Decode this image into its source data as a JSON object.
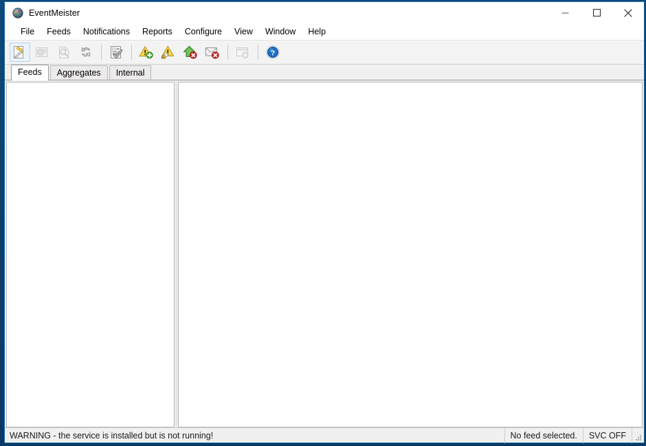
{
  "window": {
    "title": "EventMeister",
    "app_icon": "app-globe-icon",
    "controls": {
      "minimize": "Minimize",
      "maximize": "Maximize",
      "close": "Close"
    }
  },
  "menubar": {
    "items": [
      {
        "label": "File"
      },
      {
        "label": "Feeds"
      },
      {
        "label": "Notifications"
      },
      {
        "label": "Reports"
      },
      {
        "label": "Configure"
      },
      {
        "label": "View"
      },
      {
        "label": "Window"
      },
      {
        "label": "Help"
      }
    ]
  },
  "toolbar": {
    "buttons": [
      {
        "icon": "new-feed-wand-icon",
        "title": "New feed",
        "enabled": true,
        "selected": true
      },
      {
        "icon": "edit-feed-icon",
        "title": "Edit feed",
        "enabled": false,
        "selected": false
      },
      {
        "icon": "view-feed-icon",
        "title": "View feed",
        "enabled": false,
        "selected": false
      },
      {
        "icon": "refresh-icon",
        "title": "Refresh",
        "enabled": true,
        "selected": false
      },
      {
        "separator": true
      },
      {
        "icon": "document-check-icon",
        "title": "Acknowledge",
        "enabled": true,
        "selected": false
      },
      {
        "separator": true
      },
      {
        "icon": "warning-add-icon",
        "title": "Add notification",
        "enabled": true,
        "selected": false
      },
      {
        "icon": "warning-edit-icon",
        "title": "Edit notification",
        "enabled": true,
        "selected": false
      },
      {
        "icon": "home-delete-icon",
        "title": "Delete notification",
        "enabled": true,
        "selected": false
      },
      {
        "icon": "mail-delete-icon",
        "title": "Delete mail notification",
        "enabled": true,
        "selected": false
      },
      {
        "separator": true
      },
      {
        "icon": "window-add-icon",
        "title": "New window",
        "enabled": false,
        "selected": false
      },
      {
        "separator": true
      },
      {
        "icon": "help-icon",
        "title": "Help",
        "enabled": true,
        "selected": false
      }
    ]
  },
  "tabs": [
    {
      "label": "Feeds",
      "active": true
    },
    {
      "label": "Aggregates",
      "active": false
    },
    {
      "label": "Internal",
      "active": false
    }
  ],
  "panels": {
    "left": {
      "content": ""
    },
    "right": {
      "content": ""
    }
  },
  "statusbar": {
    "warning": "WARNING - the service is installed but is not running!",
    "selection": "No feed selected.",
    "service_state": "SVC OFF",
    "grip": "resize-grip-icon"
  },
  "colors": {
    "desktop": "#0b3c66",
    "window_border": "#1565a8",
    "titlebar": "#ffffff",
    "toolbar": "#f3f3f3",
    "tabstrip": "#f0f0f0",
    "panel": "#ffffff",
    "statusbar": "#f0f0f0",
    "accent_blue": "#1b6fc4",
    "warning_yellow": "#f2d24b",
    "error_red": "#cf2020",
    "ok_green": "#3f9c35"
  }
}
